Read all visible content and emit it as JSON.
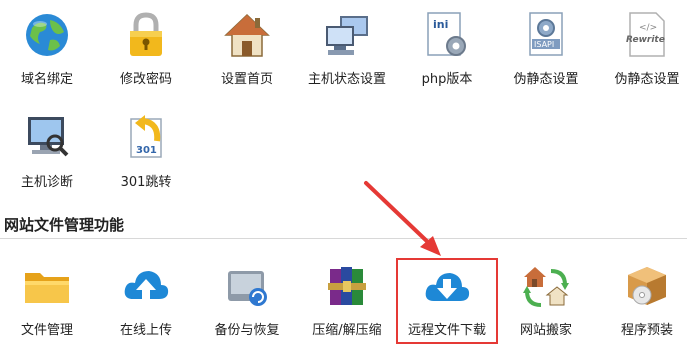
{
  "top_row": [
    {
      "label": "域名绑定",
      "icon": "globe-icon"
    },
    {
      "label": "修改密码",
      "icon": "padlock-icon"
    },
    {
      "label": "设置首页",
      "icon": "home-icon"
    },
    {
      "label": "主机状态设置",
      "icon": "computers-icon"
    },
    {
      "label": "php版本",
      "icon": "ini-config-icon"
    },
    {
      "label": "伪静态设置",
      "icon": "isapi-icon"
    },
    {
      "label": "伪静态设置",
      "icon": "rewrite-icon"
    }
  ],
  "second_row": [
    {
      "label": "主机诊断",
      "icon": "monitor-magnifier-icon"
    },
    {
      "label": "301跳转",
      "icon": "redirect-301-icon"
    }
  ],
  "section": {
    "title": "网站文件管理功能"
  },
  "bottom_row": [
    {
      "label": "文件管理",
      "icon": "folder-icon"
    },
    {
      "label": "在线上传",
      "icon": "cloud-upload-icon"
    },
    {
      "label": "备份与恢复",
      "icon": "backup-disk-icon"
    },
    {
      "label": "压缩/解压缩",
      "icon": "archive-books-icon"
    },
    {
      "label": "远程文件下载",
      "icon": "cloud-download-icon"
    },
    {
      "label": "网站搬家",
      "icon": "site-move-icon"
    },
    {
      "label": "程序预装",
      "icon": "package-disc-icon"
    }
  ],
  "colors": {
    "highlight": "#e53935",
    "arrow": "#e53935",
    "cloud": "#1e88d6"
  }
}
